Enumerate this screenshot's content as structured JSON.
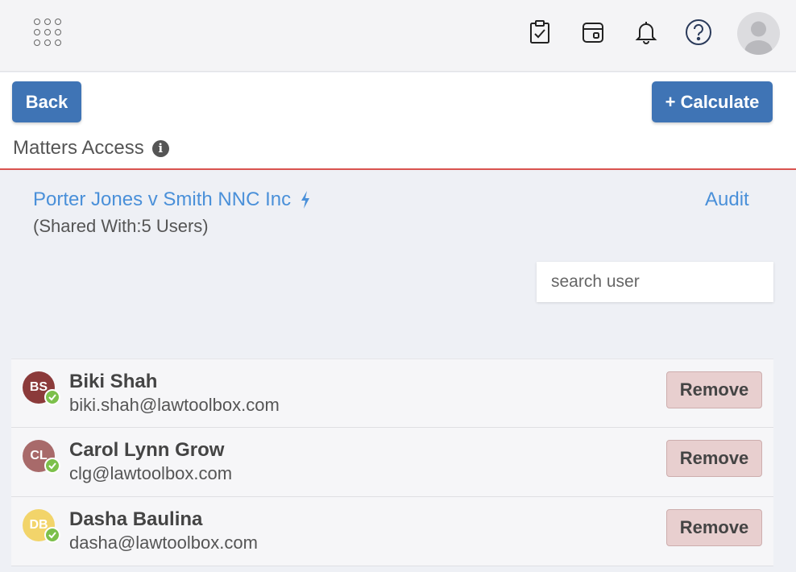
{
  "topbar": {
    "icons": [
      "apps-grid-icon",
      "clipboard-check-icon",
      "calendar-icon",
      "bell-icon",
      "help-icon",
      "user-avatar-icon"
    ]
  },
  "header": {
    "back_label": "Back",
    "calculate_label": "+ Calculate",
    "title": "Matters Access",
    "info_icon": "info-icon"
  },
  "matter": {
    "name": "Porter Jones v Smith NNC Inc",
    "shared_text": "(Shared With:5 Users)",
    "audit_label": "Audit"
  },
  "search": {
    "placeholder": "search user",
    "value": ""
  },
  "users": [
    {
      "initials": "BS",
      "name": "Biki Shah",
      "email": "biki.shah@lawtoolbox.com",
      "avatar_color": "#8b3a3a",
      "remove_label": "Remove"
    },
    {
      "initials": "CL",
      "name": "Carol Lynn Grow",
      "email": "clg@lawtoolbox.com",
      "avatar_color": "#a86a6a",
      "remove_label": "Remove"
    },
    {
      "initials": "DB",
      "name": "Dasha Baulina",
      "email": "dasha@lawtoolbox.com",
      "avatar_color": "#f2d46a",
      "remove_label": "Remove"
    }
  ],
  "colors": {
    "primary": "#3f74b5",
    "link": "#4a90d9",
    "divider": "#d9534f",
    "verified": "#7cc04b",
    "remove_bg": "#e8cfcf"
  }
}
